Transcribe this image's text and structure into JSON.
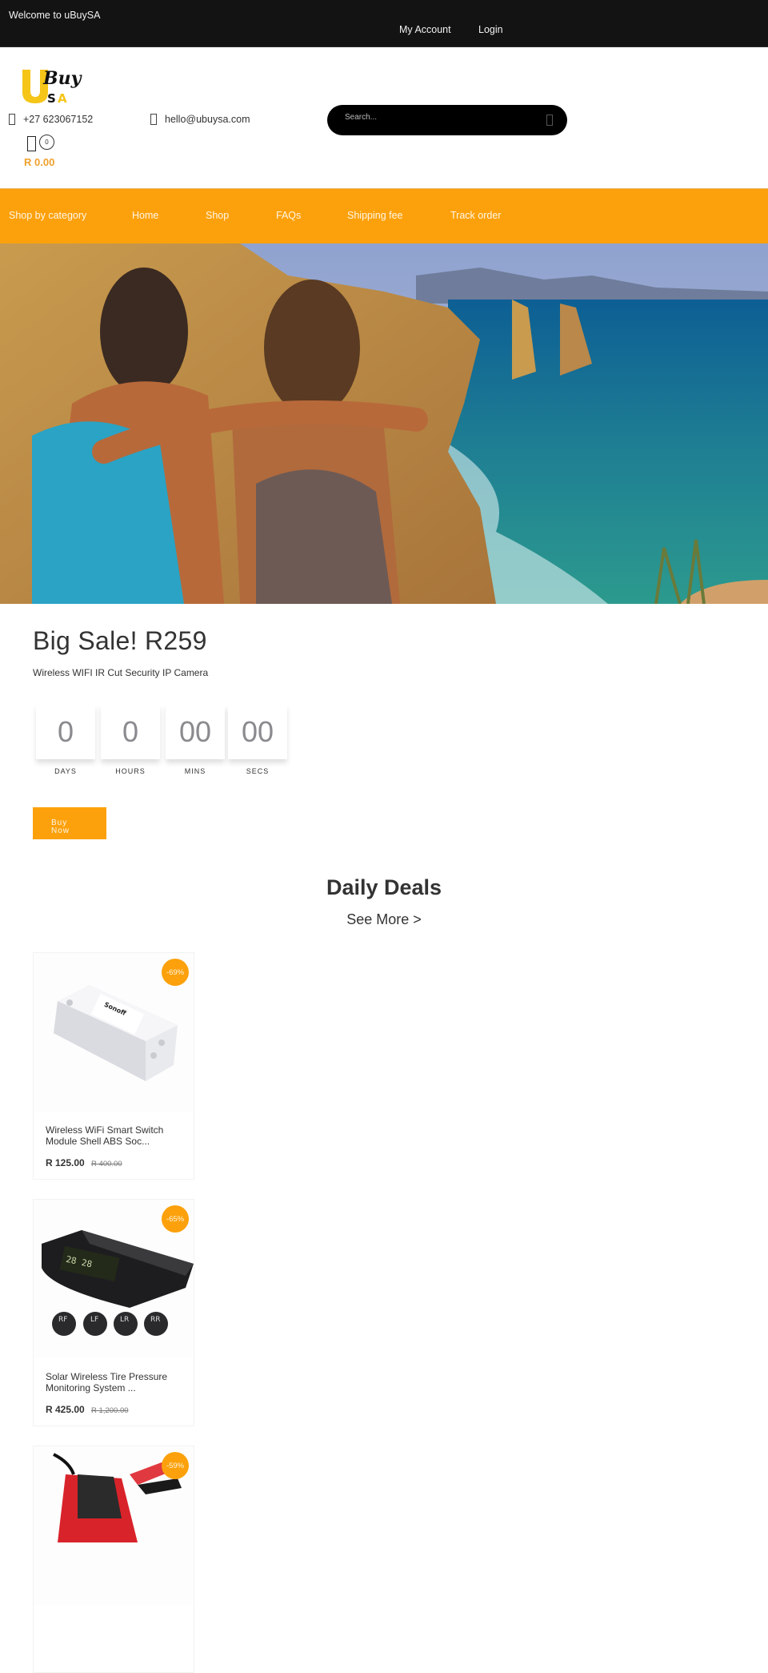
{
  "topbar": {
    "welcome": "Welcome to uBuySA",
    "my_account": "My Account",
    "login": "Login"
  },
  "header": {
    "logo_alt": "uBuySA logo",
    "phone_icon": "phone-icon",
    "phone": "+27 623067152",
    "email_icon": "email-icon",
    "email": "hello@ubuysa.com",
    "search_placeholder": "Search...",
    "search_icon": "search-icon",
    "cart_icon": "shopping-bag-icon",
    "cart_count": "0",
    "cart_total": "R 0.00"
  },
  "nav": {
    "items": [
      {
        "label": "Shop by category"
      },
      {
        "label": "Home"
      },
      {
        "label": "Shop"
      },
      {
        "label": "FAQs"
      },
      {
        "label": "Shipping fee"
      },
      {
        "label": "Track order"
      }
    ]
  },
  "hero": {
    "alt": "Two travellers with backpacks overlooking coastal cliffs and sea"
  },
  "sale": {
    "title": "Big Sale! R259",
    "subtitle": "Wireless WIFI IR Cut Security IP Camera",
    "countdown": [
      {
        "value": "0",
        "label": "DAYS"
      },
      {
        "value": "0",
        "label": "HOURS"
      },
      {
        "value": "00",
        "label": "MINS"
      },
      {
        "value": "00",
        "label": "SECS"
      }
    ],
    "buy_line1": "Buy",
    "buy_line2": "Now"
  },
  "colors": {
    "accent": "#fca10c",
    "topbar": "#131313",
    "price_accent": "#f0a02d"
  },
  "daily_deals": {
    "title": "Daily Deals",
    "see_more": "See More >",
    "products": [
      {
        "name_line1": "Wireless WiFi Smart Switch",
        "name_line2": "Module Shell ABS Soc...",
        "price": "R 125.00",
        "old_price": "R 400.00",
        "discount": "-69%"
      },
      {
        "name_line1": "Solar Wireless Tire Pressure",
        "name_line2": "Monitoring System ...",
        "price": "R 425.00",
        "old_price": "R 1,200.00",
        "discount": "-65%"
      },
      {
        "name_line1": "",
        "name_line2": "",
        "price": "",
        "old_price": "",
        "discount": "-59%"
      }
    ]
  }
}
